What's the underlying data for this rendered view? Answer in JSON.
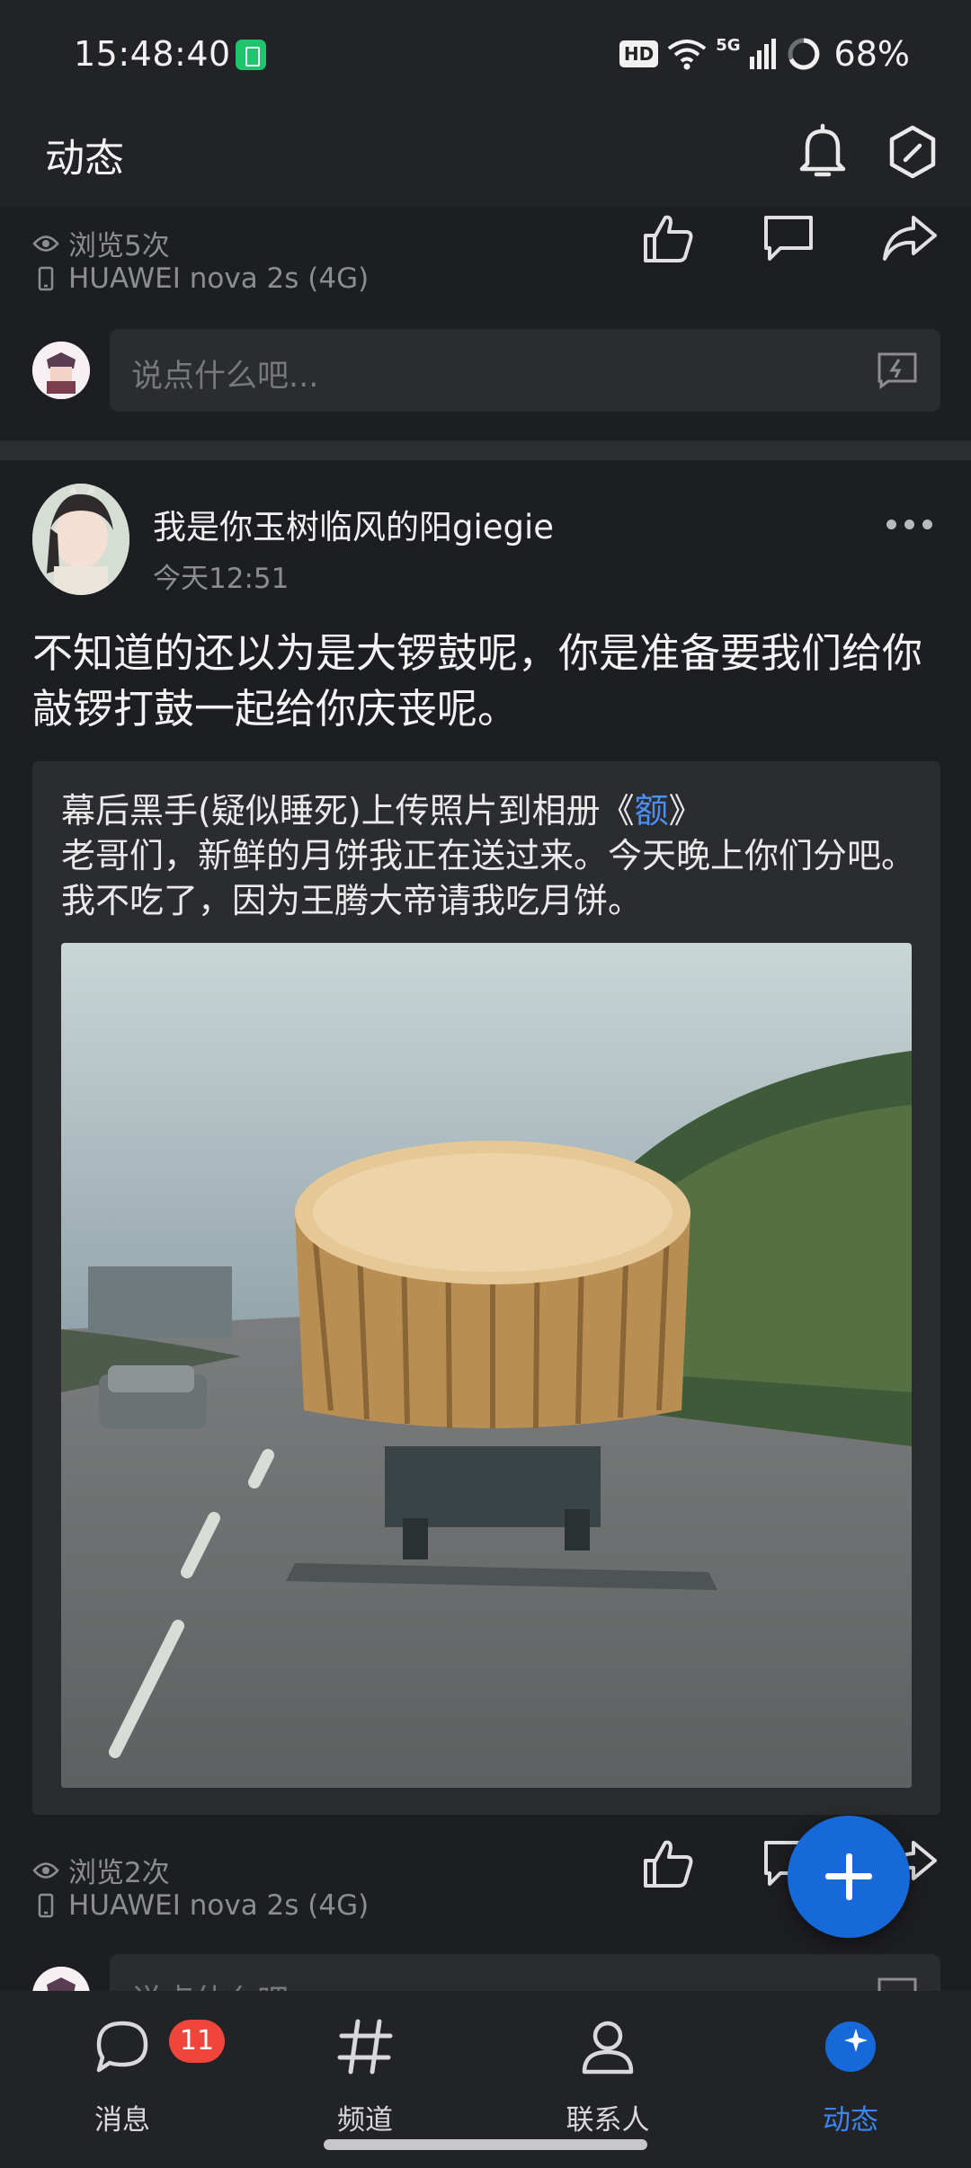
{
  "status_bar": {
    "time": "15:48:40",
    "hd": "HD",
    "network": "5G",
    "battery_percent": "68%"
  },
  "header": {
    "title": "动态",
    "icons": [
      "bell-icon",
      "hexagon-slash-icon"
    ]
  },
  "previous_post": {
    "views": "浏览5次",
    "device": "HUAWEI nova 2s (4G)",
    "comment_placeholder": "说点什么吧..."
  },
  "post": {
    "author": "我是你玉树临风的阳giegie",
    "time": "今天12:51",
    "text": "不知道的还以为是大锣鼓呢，你是准备要我们给你敲锣打鼓一起给你庆丧呢。",
    "shared": {
      "header_prefix": "幕后黑手(疑似睡死)上传照片到相册《",
      "album_name": "额",
      "header_suffix": "》",
      "body": "老哥们，新鲜的月饼我正在送过来。今天晚上你们分吧。我不吃了，因为王腾大帝请我吃月饼。"
    },
    "views": "浏览2次",
    "device": "HUAWEI nova 2s (4G)",
    "comment_placeholder": "说点什么吧..."
  },
  "bottom_nav": {
    "items": [
      {
        "label": "消息",
        "badge": "11",
        "icon": "chat-bubble-icon"
      },
      {
        "label": "频道",
        "icon": "hashtag-icon"
      },
      {
        "label": "联系人",
        "icon": "person-icon"
      },
      {
        "label": "动态",
        "icon": "star-bubble-icon",
        "active": true
      }
    ]
  },
  "colors": {
    "accent": "#1768d8",
    "link": "#4a8ff5",
    "badge": "#f0453a"
  }
}
